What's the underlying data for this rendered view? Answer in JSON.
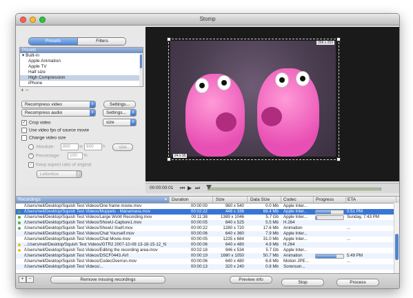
{
  "window": {
    "title": "Stomp"
  },
  "sidebar": {
    "tabs": [
      {
        "label": "Presets"
      },
      {
        "label": "Filters"
      }
    ],
    "preset_header": "Presets",
    "presets": [
      {
        "label": "Built-in"
      },
      {
        "label": "Apple Animation"
      },
      {
        "label": "Apple TV"
      },
      {
        "label": "Half size"
      },
      {
        "label": "High Compression"
      },
      {
        "label": "iPhone"
      }
    ],
    "add_remove": "+ −",
    "video_codec": "Recompress video",
    "audio_codec": "Recompress audio",
    "settings_label": "Settings...",
    "settings_label2": "Settings...",
    "size_popup": "size",
    "crop_video": "Crop video",
    "use_fps": "Use video fps of source movie",
    "change_size": "Change video size",
    "absolute_label": "Absolute:",
    "width_value": "800",
    "w_label": "w",
    "height_value": "600",
    "h_label": "h",
    "size_button": "size",
    "percentage_label": "Percentage:",
    "percentage_value": "100",
    "percent_sign": "%",
    "keep_aspect": "Keep aspect ratio of original",
    "letterbox": "Letterbox"
  },
  "viewer": {
    "crop_top_right": "358 x 253",
    "crop_bottom_left": "24 x 35",
    "timecode": "00:00:00:01",
    "playhead_fraction": 0.0
  },
  "recordings": {
    "columns": [
      "Recordings",
      "Duration",
      "Size",
      "Data Size",
      "Codec",
      "Progress",
      "ETA"
    ],
    "rows": [
      {
        "status": "none",
        "path": "/Users/neil/Desktop/Squish Test Videos/One frame movie.mov",
        "duration": "00:00:00",
        "size": "960 x 540",
        "data": "0.0 Mb",
        "codec": "Apple Inter...",
        "progress": null,
        "eta": ""
      },
      {
        "status": "green",
        "path": "/Users/neil/Desktop/Squish Test Videos/Muppets - Manamana.mov",
        "duration": "00:02:22",
        "size": "446 x 336",
        "data": "68.4 Mb",
        "codec": "Apple Inter...",
        "progress": 0.55,
        "eta": "5:51 PM"
      },
      {
        "status": "green",
        "path": "/Users/neil/Desktop/Squish Test Videos/Large WoW Recording.mov",
        "duration": "00:11:38",
        "size": "1389 x 1046",
        "data": "5.7 Gb",
        "codec": "Apple Inter...",
        "progress": 0.05,
        "eta": "Sunday, 7:43 PM"
      },
      {
        "status": "green",
        "path": "/Users/neil/Desktop/Squish Test Videos/ShowU-Capture1.mov",
        "duration": "00:00:05",
        "size": "840 x 525",
        "data": "5.5 Mb",
        "codec": "H.264",
        "progress": null,
        "eta": ""
      },
      {
        "status": "green",
        "path": "/Users/neil/Desktop/Squish Test Videos/ShowU Itself.mov",
        "duration": "00:00:22",
        "size": "1280 x 720",
        "data": "17.6 Mb",
        "codec": "Animation",
        "progress": null,
        "eta": "..."
      },
      {
        "status": "none",
        "path": "/Users/neil/Desktop/Squish Test Videos/Chat Yourself.mov",
        "duration": "00:00:06",
        "size": "640 x 360",
        "data": "7.9 Mb",
        "codec": "Apple Inter...",
        "progress": null,
        "eta": ""
      },
      {
        "status": "none",
        "path": "/Users/neil/Desktop/Squish Test Videos/Chat Movie.mov",
        "duration": "00:00:05",
        "size": "1235 x 684",
        "data": "31.0 Mb",
        "codec": "Apple Inter...",
        "progress": null,
        "eta": "..."
      },
      {
        "status": "yellow",
        "path": "...Users/neil/Desktop/Squish Test Videos/GTR2 2007-10-08 13-18-15-12_New.avi",
        "duration": "00:00:06",
        "size": "640 x 480",
        "data": "4.9 Mb",
        "codec": "H.264",
        "progress": null,
        "eta": ""
      },
      {
        "status": "yellow",
        "path": "/Users/neil/Desktop/Squish Test Videos/Editing the recording area.mov",
        "duration": "00:02:18",
        "size": "946 x 534",
        "data": "5.7 Gb",
        "codec": "Apple Inter...",
        "progress": null,
        "eta": ""
      },
      {
        "status": "none",
        "path": "/Users/neil/Desktop/Squish Test Videos/DSCF0443.AVI",
        "duration": "00:00:19",
        "size": "1680 x 1050",
        "data": "50.7 Mb",
        "codec": "Animation",
        "progress": 0.75,
        "eta": "5:49 PM"
      },
      {
        "status": "none",
        "path": "/Users/neil/Desktop/Squish Test Videos/CodecOverrun.mov",
        "duration": "00:00:06",
        "size": "640 x 480",
        "data": "6.8 Mb",
        "codec": "Motion JPE...",
        "progress": null,
        "eta": "..."
      },
      {
        "status": "none",
        "path": "/Users/neil/Desktop/Squish Test Videos/...",
        "duration": "00:00:13",
        "size": "320 x 240",
        "data": "0.8 Mb",
        "codec": "Sorenson...",
        "progress": null,
        "eta": ""
      }
    ]
  },
  "bottombar": {
    "remove_missing": "Remove missing recordings",
    "preview_info": "Preview info",
    "stop": "Stop",
    "process": "Process"
  },
  "colors": {
    "selection": "#3875d7",
    "green": "#4fb13c",
    "yellow": "#e6c21a",
    "accent": "#5a8ad0"
  }
}
